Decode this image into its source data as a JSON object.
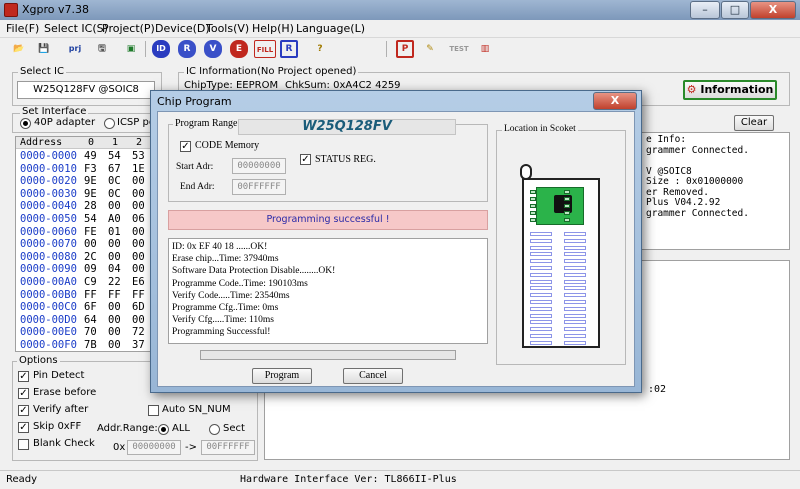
{
  "window": {
    "title": "Xgpro v7.38",
    "controls": [
      "–",
      "□",
      "X"
    ]
  },
  "menu": [
    "File(F)",
    "Select IC(S)",
    "Project(P)",
    "Device(D)",
    "Tools(V)",
    "Help(H)",
    "Language(L)"
  ],
  "toolbar": {
    "buttons": [
      {
        "name": "open-file",
        "glyph": "📂"
      },
      {
        "name": "save-file",
        "glyph": "💾"
      },
      {
        "name": "open-project",
        "glyph": "prj"
      },
      {
        "name": "save-project",
        "glyph": "🖫"
      },
      {
        "name": "save-as",
        "glyph": "▣"
      },
      {
        "name": "read-id",
        "glyph": "ID"
      },
      {
        "name": "read",
        "glyph": "R"
      },
      {
        "name": "verify",
        "glyph": "V"
      },
      {
        "name": "erase",
        "glyph": "E"
      },
      {
        "name": "fill",
        "glyph": "FILL"
      },
      {
        "name": "read-r",
        "glyph": "R"
      },
      {
        "name": "hint",
        "glyph": "?"
      },
      {
        "name": "program",
        "glyph": "P"
      },
      {
        "name": "edit",
        "glyph": "✎"
      },
      {
        "name": "test",
        "glyph": "TEST"
      },
      {
        "name": "chip-info",
        "glyph": "▥"
      }
    ]
  },
  "select_ic": {
    "label": "Select IC",
    "value": "W25Q128FV @SOIC8"
  },
  "ic_info": {
    "label": "IC Information(No Project opened)",
    "chip_type": "ChipType:  EEPROM",
    "checksum": "ChkSum:  0xA4C2 4259",
    "info_button": "Information",
    "clear_button": "Clear"
  },
  "set_interface": {
    "label": "Set Interface",
    "options": [
      "40P adapter",
      "ICSP port"
    ],
    "selected": "40P adapter"
  },
  "hex": {
    "header": [
      "Address",
      "0",
      "1",
      "2"
    ],
    "rows": [
      {
        "addr": "0000-0000",
        "b0": "49",
        "b1": "54",
        "b2": "53"
      },
      {
        "addr": "0000-0010",
        "b0": "F3",
        "b1": "67",
        "b2": "1E"
      },
      {
        "addr": "0000-0020",
        "b0": "9E",
        "b1": "0C",
        "b2": "00"
      },
      {
        "addr": "0000-0030",
        "b0": "9E",
        "b1": "0C",
        "b2": "00"
      },
      {
        "addr": "0000-0040",
        "b0": "28",
        "b1": "00",
        "b2": "00"
      },
      {
        "addr": "0000-0050",
        "b0": "54",
        "b1": "A0",
        "b2": "06"
      },
      {
        "addr": "0000-0060",
        "b0": "FE",
        "b1": "01",
        "b2": "00"
      },
      {
        "addr": "0000-0070",
        "b0": "00",
        "b1": "00",
        "b2": "00"
      },
      {
        "addr": "0000-0080",
        "b0": "2C",
        "b1": "00",
        "b2": "00"
      },
      {
        "addr": "0000-0090",
        "b0": "09",
        "b1": "04",
        "b2": "00"
      },
      {
        "addr": "0000-00A0",
        "b0": "C9",
        "b1": "22",
        "b2": "E6"
      },
      {
        "addr": "0000-00B0",
        "b0": "FF",
        "b1": "FF",
        "b2": "FF"
      },
      {
        "addr": "0000-00C0",
        "b0": "6F",
        "b1": "00",
        "b2": "6D"
      },
      {
        "addr": "0000-00D0",
        "b0": "64",
        "b1": "00",
        "b2": "00"
      },
      {
        "addr": "0000-00E0",
        "b0": "70",
        "b1": "00",
        "b2": "72"
      },
      {
        "addr": "0000-00F0",
        "b0": "7B",
        "b1": "00",
        "b2": "37"
      }
    ]
  },
  "device_log_lines": [
    "e Info:",
    "grammer Connected.",
    "",
    "V @SOIC8",
    "Size : 0x01000000",
    "er Removed.",
    "Plus V04.2.92",
    "grammer Connected."
  ],
  "bottom_right_fragment": ":02",
  "options": {
    "label": "Options",
    "pin_detect": "Pin Detect",
    "erase_before": "Erase before",
    "verify_after": "Verify after",
    "skip_off": "Skip 0xFF",
    "blank_check": "Blank Check",
    "auto_sn": "Auto SN_NUM",
    "addr_range": "Addr.Range:",
    "all": "ALL",
    "sect": "Sect",
    "ox": "0x",
    "addr_from": "00000000",
    "arrow": "->",
    "addr_to": "00FFFFFF"
  },
  "status": {
    "ready": "Ready",
    "hardware": "Hardware Interface Ver: TL866II-Plus"
  },
  "dialog": {
    "title": "Chip Program",
    "program_range_label": "Program Range",
    "chip_name": "W25Q128FV",
    "code_memory": "CODE Memory",
    "start_adr_label": "Start Adr:",
    "start_adr": "00000000",
    "end_adr_label": "End Adr:",
    "end_adr": "00FFFFFF",
    "status_reg": "STATUS REG.",
    "result_banner": "Programming successful !",
    "log": [
      "ID: 0x EF 40 18 ......OK!",
      "Erase chip...Time: 37940ms",
      "Software Data Protection Disable........OK!",
      "Programme Code..Time: 190103ms",
      "Verify Code.....Time: 23540ms",
      "Programme Cfg..Time: 0ms",
      "Verify Cfg.....Time: 110ms",
      "Programming Successful!"
    ],
    "progress": 0,
    "location_label": "Location in Scoket",
    "program_button": "Program",
    "cancel_button": "Cancel"
  },
  "colors": {
    "hex_address": "#1a3cc8",
    "banner_bg": "#f6c8c8",
    "banner_text": "#2a2aa8",
    "chip_green": "#2bb34a",
    "socket_pin": "#8d95e8",
    "chip_title": "#1a5c7a"
  }
}
